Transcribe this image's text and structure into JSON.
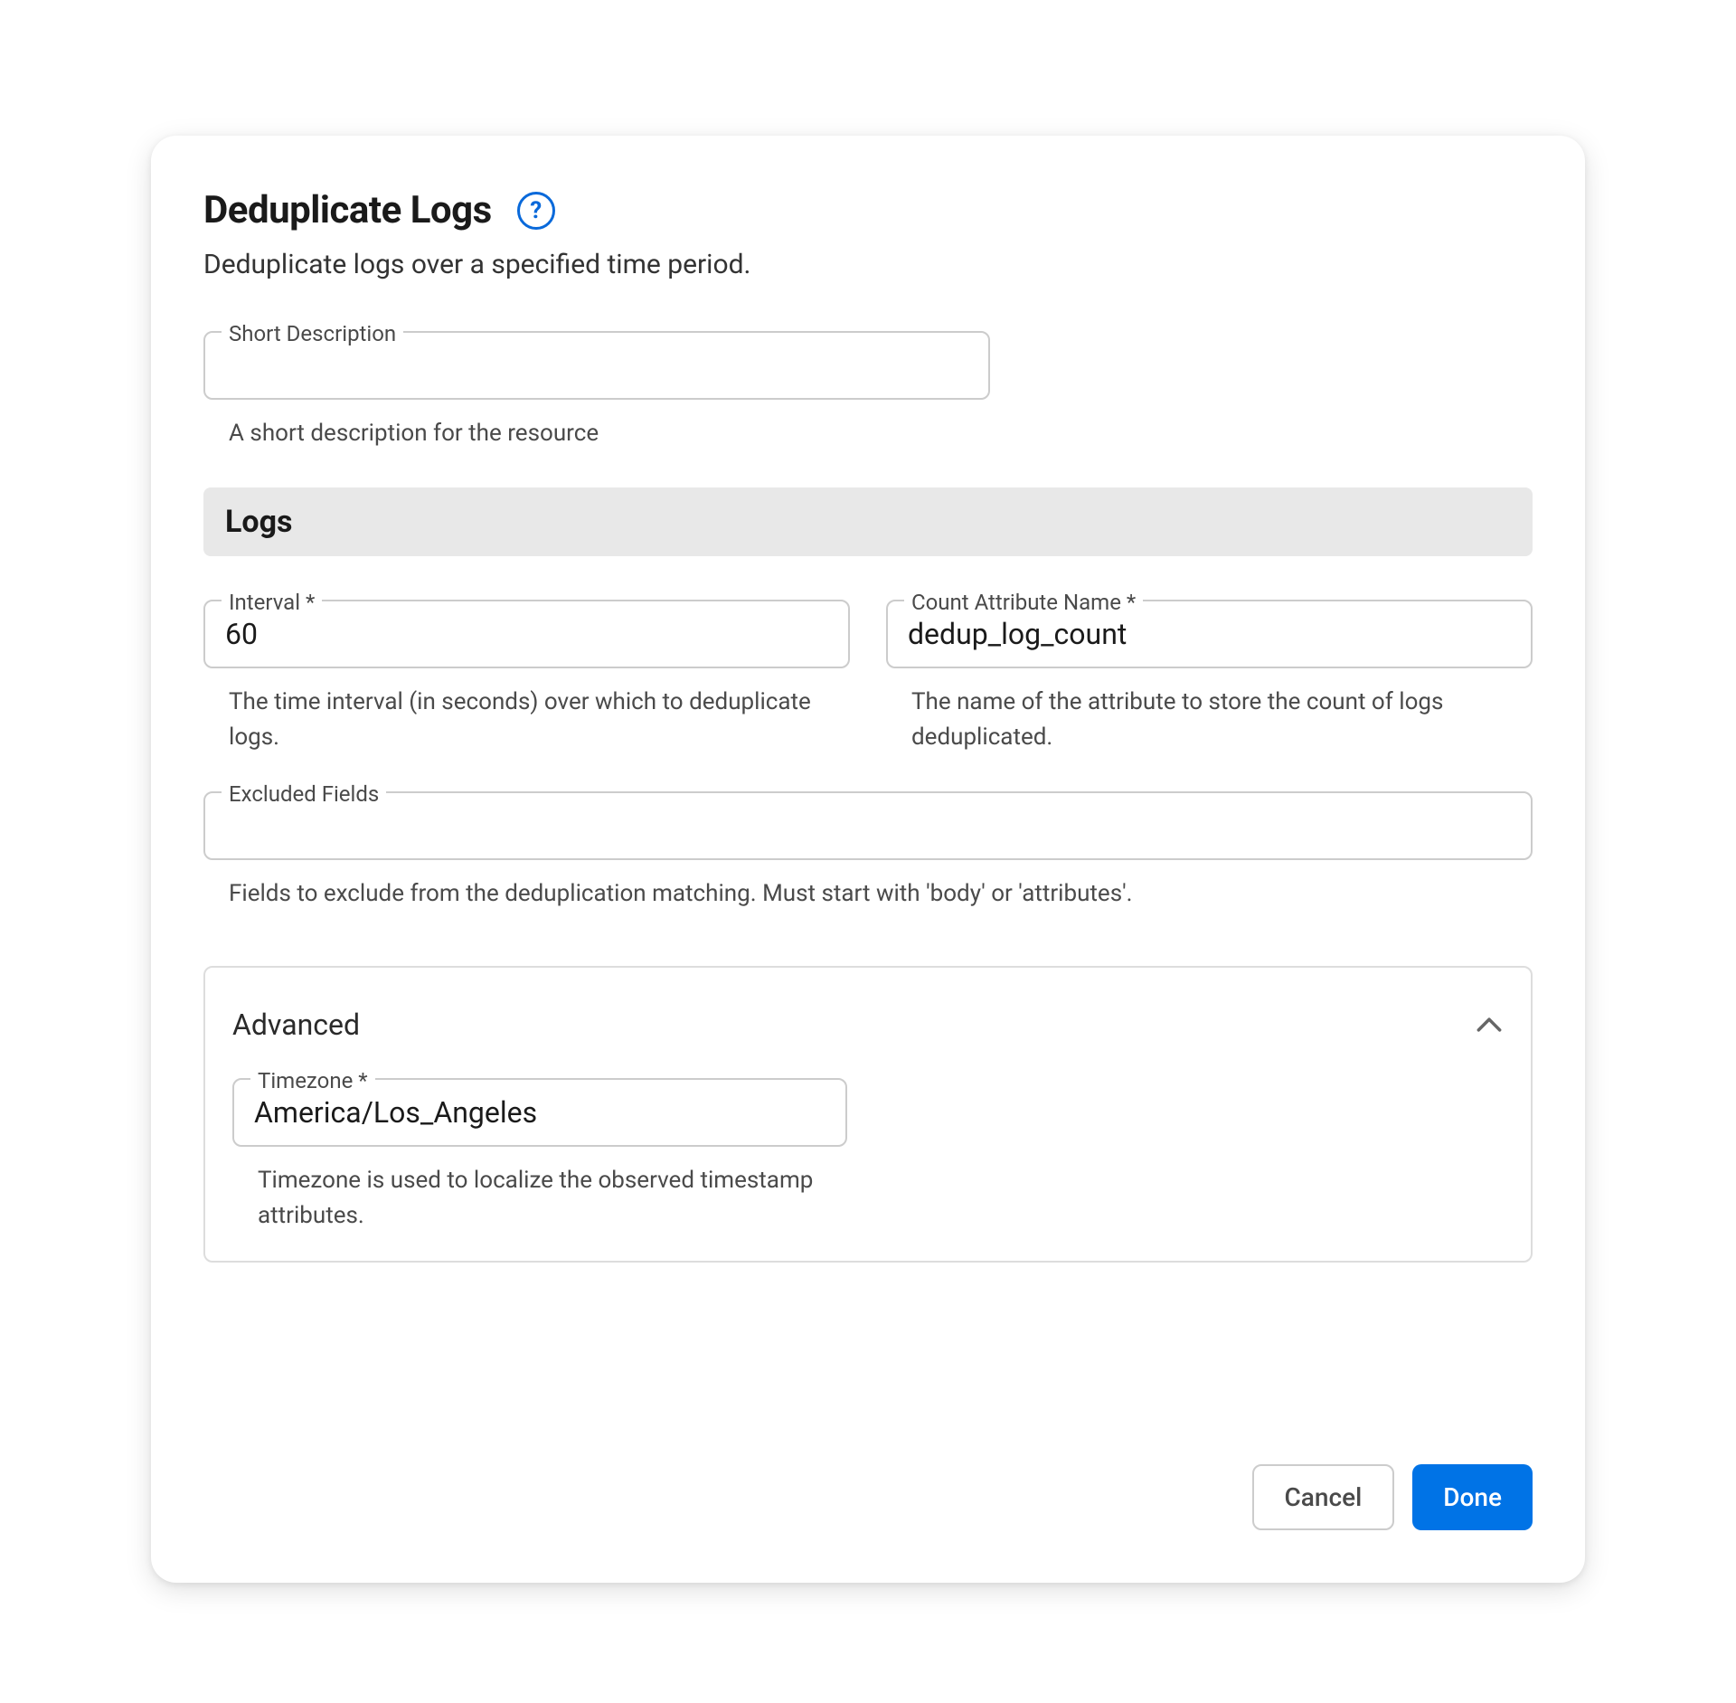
{
  "dialog": {
    "title": "Deduplicate Logs",
    "subtitle": "Deduplicate logs over a specified time period."
  },
  "fields": {
    "shortDescription": {
      "label": "Short Description",
      "value": "",
      "helper": "A short description for the resource"
    },
    "interval": {
      "label": "Interval *",
      "value": "60",
      "helper": "The time interval (in seconds) over which to deduplicate logs."
    },
    "countAttribute": {
      "label": "Count Attribute Name *",
      "value": "dedup_log_count",
      "helper": "The name of the attribute to store the count of logs deduplicated."
    },
    "excludedFields": {
      "label": "Excluded Fields",
      "value": "",
      "helper": "Fields to exclude from the deduplication matching. Must start with 'body' or 'attributes'."
    },
    "timezone": {
      "label": "Timezone *",
      "value": "America/Los_Angeles",
      "helper": "Timezone is used to localize the observed timestamp attributes."
    }
  },
  "sections": {
    "logs": "Logs",
    "advanced": "Advanced"
  },
  "buttons": {
    "cancel": "Cancel",
    "done": "Done"
  }
}
